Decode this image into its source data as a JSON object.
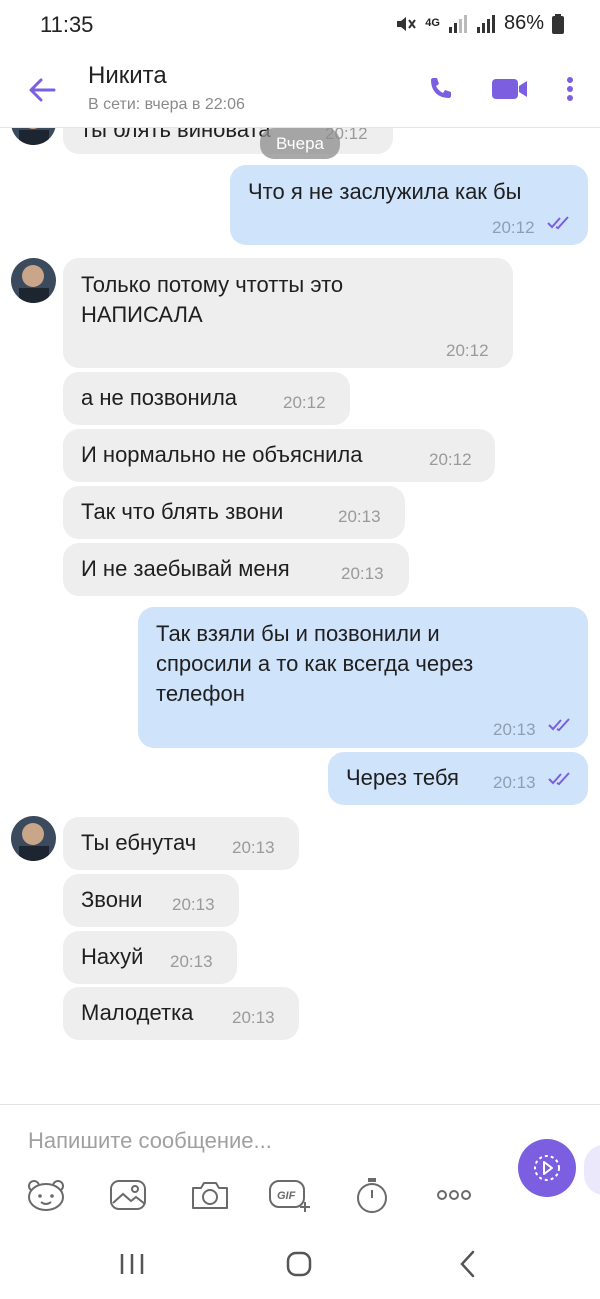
{
  "status_bar": {
    "time": "11:35",
    "network": "4G",
    "battery": "86%"
  },
  "header": {
    "contact_name": "Никита",
    "contact_status": "В сети: вчера в 22:06",
    "accent_color": "#7b5fe0"
  },
  "chat": {
    "date_divider": "Вчера",
    "partial_message": {
      "text": "ты блять виновата",
      "time": "20:12"
    },
    "messages": [
      {
        "dir": "out",
        "lines": [
          "Что я не заслужила как бы"
        ],
        "time": "20:12"
      },
      {
        "dir": "in",
        "lines": [
          "Только потому чтотты это",
          "НАПИСАЛА"
        ],
        "time": "20:12"
      },
      {
        "dir": "in",
        "lines": [
          "а не позвонила"
        ],
        "time": "20:12"
      },
      {
        "dir": "in",
        "lines": [
          "И нормально не объяснила"
        ],
        "time": "20:12"
      },
      {
        "dir": "in",
        "lines": [
          "Так что блять звони"
        ],
        "time": "20:13"
      },
      {
        "dir": "in",
        "lines": [
          "И не заебывай меня"
        ],
        "time": "20:13"
      },
      {
        "dir": "out",
        "lines": [
          "Так взяли бы и позвонили и",
          "спросили а то как всегда через",
          "телефон"
        ],
        "time": "20:13"
      },
      {
        "dir": "out",
        "lines": [
          "Через тебя"
        ],
        "time": "20:13"
      },
      {
        "dir": "in",
        "lines": [
          "Ты ебнутач"
        ],
        "time": "20:13"
      },
      {
        "dir": "in",
        "lines": [
          "Звони"
        ],
        "time": "20:13"
      },
      {
        "dir": "in",
        "lines": [
          "Нахуй"
        ],
        "time": "20:13"
      },
      {
        "dir": "in",
        "lines": [
          "Малодетка"
        ],
        "time": "20:13"
      }
    ]
  },
  "composer": {
    "placeholder": "Напишите сообщение...",
    "tools": [
      "sticker-icon",
      "gallery-icon",
      "camera-icon",
      "gif-icon",
      "timer-icon",
      "more-icon"
    ],
    "gif_label": "GIF"
  },
  "navbar": {
    "buttons": [
      "recents-icon",
      "home-icon",
      "back-icon"
    ]
  }
}
